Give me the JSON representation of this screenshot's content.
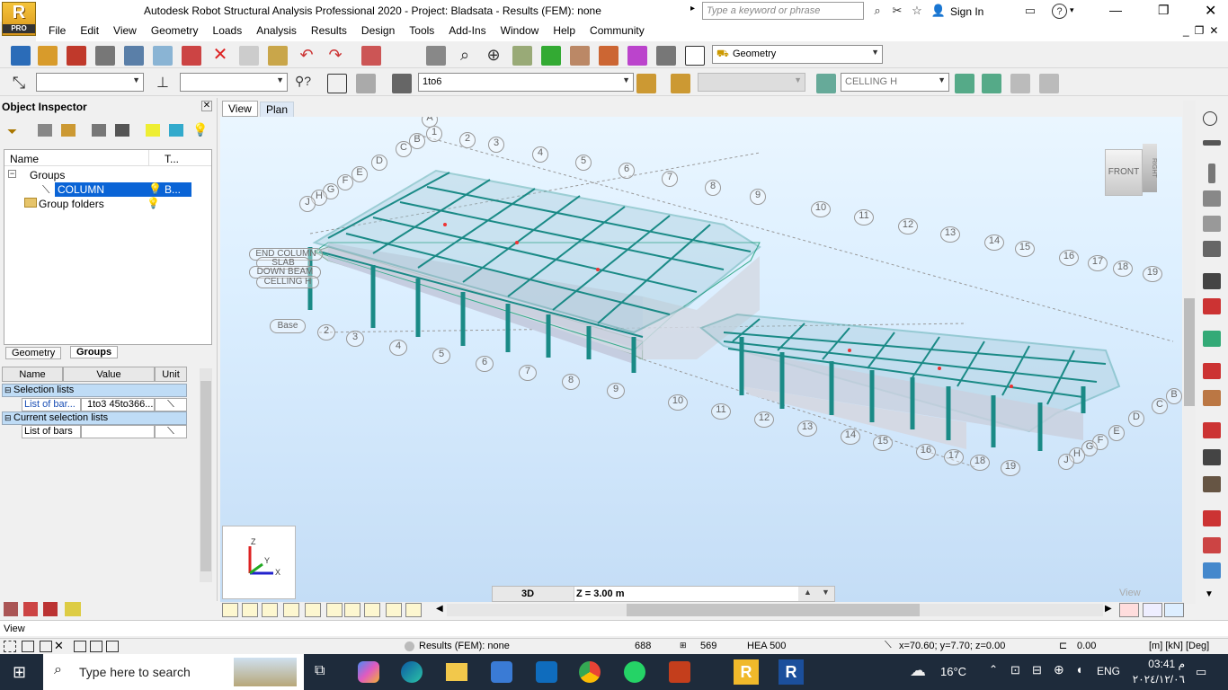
{
  "window": {
    "title": "Autodesk Robot Structural Analysis Professional 2020 - Project: Bladsata - Results (FEM): none",
    "logo_letter": "R",
    "logo_sub": "PRO",
    "search_placeholder": "Type a keyword or phrase",
    "sign_in": "Sign In"
  },
  "menu": [
    "File",
    "Edit",
    "View",
    "Geometry",
    "Loads",
    "Analysis",
    "Results",
    "Design",
    "Tools",
    "Add-Ins",
    "Window",
    "Help",
    "Community"
  ],
  "toolbar1": {
    "layout_combo": "Geometry"
  },
  "toolbar2": {
    "bar_list": "1to6",
    "story_combo": "CELLING H"
  },
  "object_inspector": {
    "title": "Object Inspector",
    "tree_headers": [
      "Name",
      "T..."
    ],
    "groups_label": "Groups",
    "column_label": "COLUMN",
    "column_type": "B...",
    "group_folders_label": "Group folders",
    "tabs": [
      "Geometry",
      "Groups"
    ]
  },
  "properties": {
    "headers": [
      "Name",
      "Value",
      "Unit"
    ],
    "section1": "Selection lists",
    "row1_name": "List of bar...",
    "row1_value": "1to3 45to366...",
    "section2": "Current selection lists",
    "row2_name": "List of bars"
  },
  "viewport": {
    "tabs": [
      "View",
      "Plan"
    ],
    "mode_label": "3D",
    "z_label": "Z = 3.00 m",
    "view_cube": "FRONT",
    "view_cube_side": "RIGHT",
    "watermark_view": "View",
    "axis_x": "X",
    "axis_y": "Y",
    "axis_z": "Z"
  },
  "grid_numbers": [
    "1",
    "2",
    "3",
    "4",
    "5",
    "6",
    "7",
    "8",
    "9",
    "10",
    "11",
    "12",
    "13",
    "14",
    "15",
    "16",
    "17",
    "18",
    "19"
  ],
  "grid_letters": [
    "A",
    "B",
    "C",
    "D",
    "E",
    "F",
    "G",
    "H",
    "J"
  ],
  "level_labels": [
    "END COLUMN",
    "SLAB",
    "DOWN BEAM",
    "CELLING H",
    "Base"
  ],
  "status": {
    "view_label": "View",
    "results": "Results (FEM): none",
    "count1": "688",
    "count2": "569",
    "section": "HEA 500",
    "coords": "x=70.60; y=7.70; z=0.00",
    "angle": "0.00",
    "units": "[m] [kN] [Deg]"
  },
  "taskbar": {
    "search": "Type here to search",
    "weather": "16°C",
    "lang": "ENG",
    "time": "03:41 م",
    "date": "٢٠٢٤/١٢/٠٦"
  }
}
